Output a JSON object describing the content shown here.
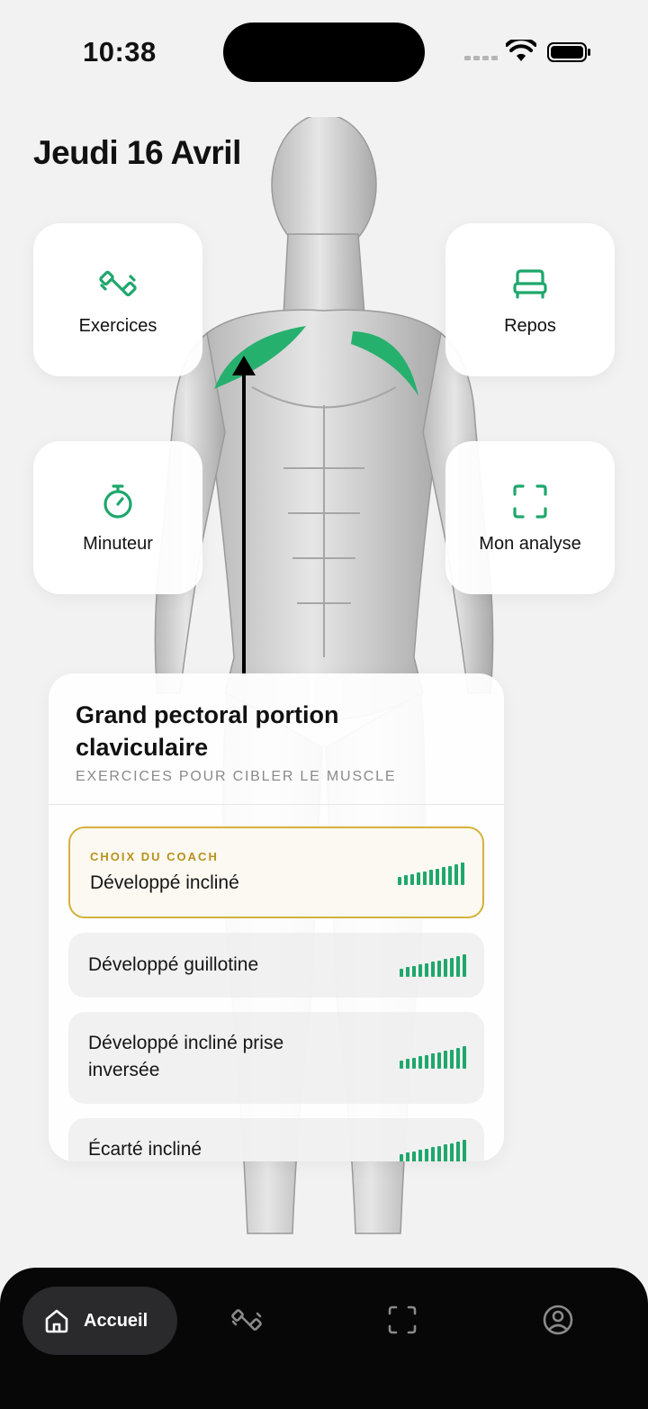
{
  "status_bar": {
    "time": "10:38"
  },
  "header": {
    "date": "Jeudi 16 Avril"
  },
  "tiles": [
    {
      "label": "Exercices",
      "icon": "dumbbell-icon"
    },
    {
      "label": "Repos",
      "icon": "bed-icon"
    },
    {
      "label": "Minuteur",
      "icon": "stopwatch-icon"
    },
    {
      "label": "Mon analyse",
      "icon": "scan-icon"
    }
  ],
  "muscle_card": {
    "title": "Grand pectoral portion claviculaire",
    "subtitle": "EXERCICES POUR CIBLER LE MUSCLE",
    "coach_tag": "CHOIX DU COACH",
    "exercises": [
      {
        "name": "Développé incliné",
        "coach_choice": true
      },
      {
        "name": "Développé guillotine",
        "coach_choice": false
      },
      {
        "name": "Développé incliné prise inversée",
        "coach_choice": false
      },
      {
        "name": "Écarté incliné",
        "coach_choice": false
      }
    ]
  },
  "bottom_nav": {
    "home_label": "Accueil",
    "items": [
      "home-icon",
      "dumbbell-icon",
      "scan-icon",
      "profile-icon"
    ]
  },
  "colors": {
    "accent_green": "#1fa76c",
    "coach_gold": "#d4b23a",
    "background": "#f2f2f2",
    "nav_background": "#070707"
  }
}
